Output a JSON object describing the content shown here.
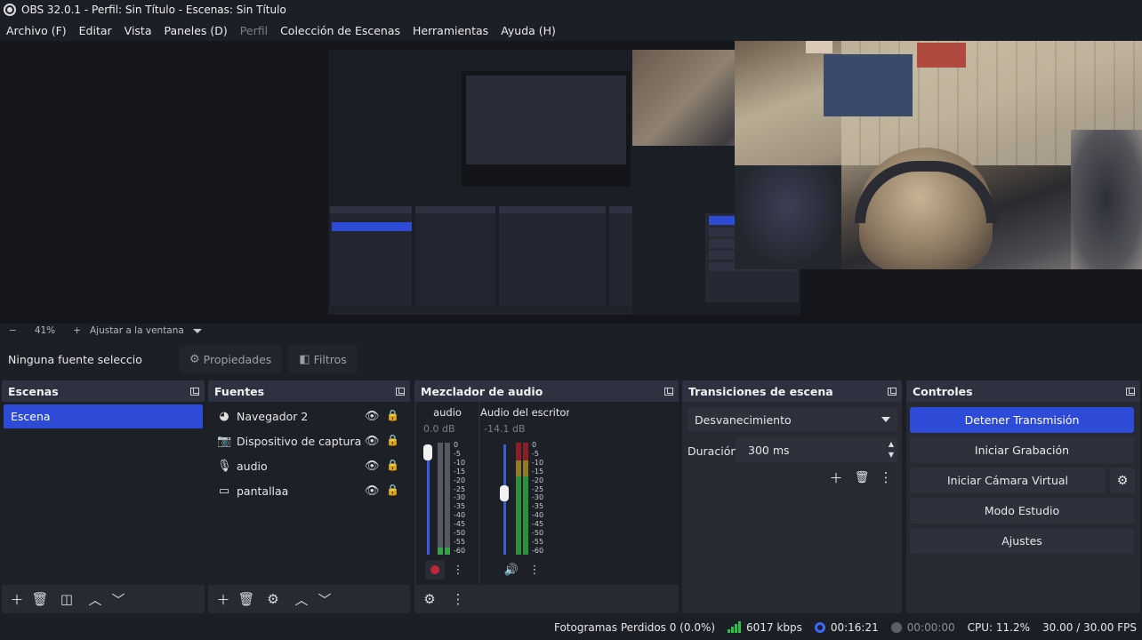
{
  "window": {
    "title": "OBS 32.0.1 - Perfil: Sin Título - Escenas: Sin Título"
  },
  "menu": [
    {
      "label": "Archivo (F)",
      "disabled": false
    },
    {
      "label": "Editar",
      "disabled": false
    },
    {
      "label": "Vista",
      "disabled": false
    },
    {
      "label": "Paneles (D)",
      "disabled": false
    },
    {
      "label": "Perfil",
      "disabled": true
    },
    {
      "label": "Colección de Escenas",
      "disabled": false
    },
    {
      "label": "Herramientas",
      "disabled": false
    },
    {
      "label": "Ayuda (H)",
      "disabled": false
    }
  ],
  "preview": {
    "zoom": "41%",
    "fit_label": "Ajustar a la ventana"
  },
  "source_toolbar": {
    "no_selection": "Ninguna fuente seleccionad",
    "properties": "Propiedades",
    "filters": "Filtros"
  },
  "scenes": {
    "title": "Escenas",
    "items": [
      "Escena"
    ],
    "active_index": 0
  },
  "sources": {
    "title": "Fuentes",
    "items": [
      {
        "name": "Navegador 2",
        "icon": "browser-icon"
      },
      {
        "name": "Dispositivo de captura de",
        "icon": "camera-icon"
      },
      {
        "name": "audio",
        "icon": "microphone-icon"
      },
      {
        "name": "pantallaa",
        "icon": "monitor-icon"
      }
    ]
  },
  "mixer": {
    "title": "Mezclador de audio",
    "channels": [
      {
        "name": "audio",
        "db": "0.0 dB",
        "volume": 1.0,
        "muted": true
      },
      {
        "name": "Audio del escritorio",
        "db": "-14.1 dB",
        "volume": 0.57,
        "muted": false
      }
    ],
    "scale": [
      "0",
      "-5",
      "-10",
      "-15",
      "-20",
      "-25",
      "-30",
      "-35",
      "-40",
      "-45",
      "-50",
      "-55",
      "-60"
    ]
  },
  "transitions": {
    "title": "Transiciones de escena",
    "selected": "Desvanecimiento",
    "duration_label": "Duración",
    "duration_value": "300 ms"
  },
  "controls": {
    "title": "Controles",
    "stop_stream": "Detener Transmisión",
    "start_recording": "Iniciar Grabación",
    "start_virtual_cam": "Iniciar Cámara Virtual",
    "studio_mode": "Modo Estudio",
    "settings": "Ajustes"
  },
  "status": {
    "dropped_frames": "Fotogramas Perdidos 0 (0.0%)",
    "bitrate": "6017 kbps",
    "stream_time": "00:16:21",
    "record_time": "00:00:00",
    "cpu": "CPU: 11.2%",
    "fps": "30.00 / 30.00 FPS"
  },
  "colors": {
    "accent": "#2d4bd6",
    "panel": "#272a33",
    "panel_header": "#2e3240",
    "background": "#1d1f26",
    "status_green": "#2ec14a",
    "mute_red": "#c0263a"
  }
}
